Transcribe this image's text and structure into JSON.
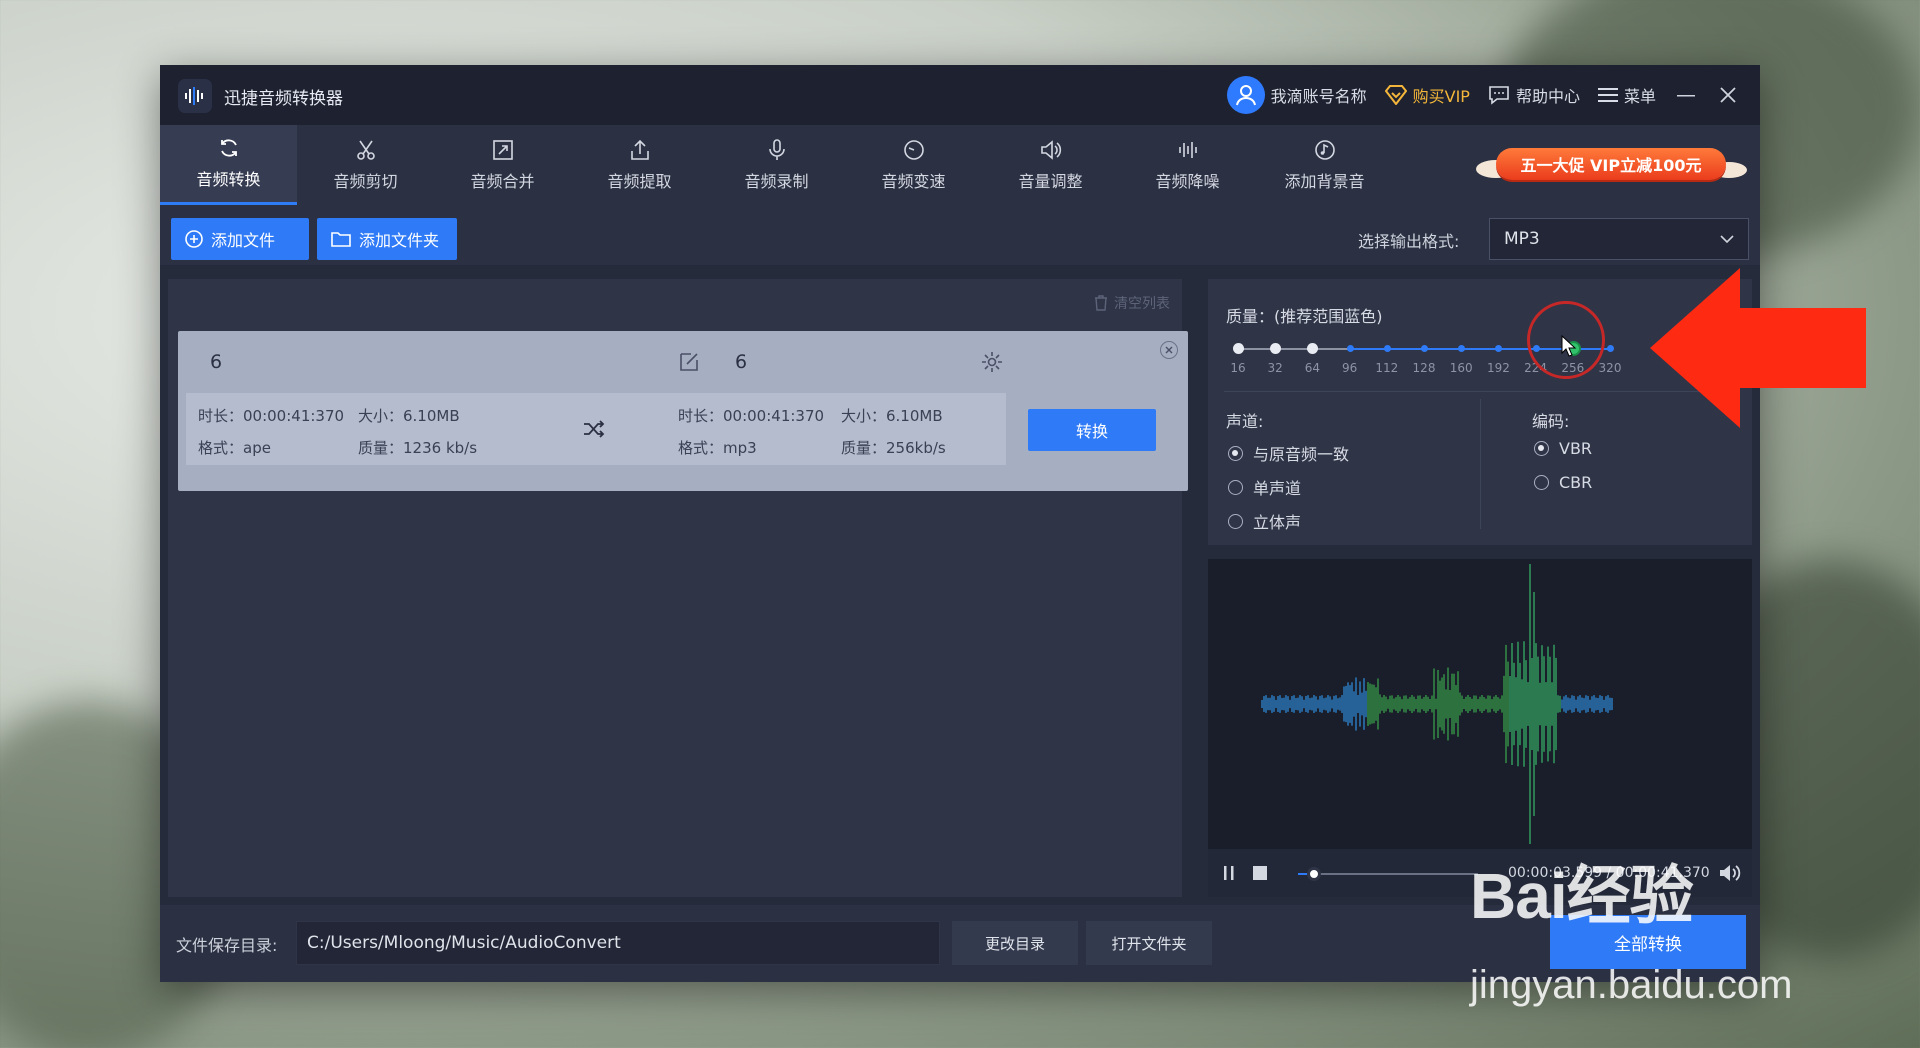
{
  "app": {
    "title": "迅捷音频转换器"
  },
  "titlebar": {
    "account_name": "我滴账号名称",
    "buy_vip": "购买VIP",
    "help_center": "帮助中心",
    "menu": "菜单"
  },
  "toolbar": {
    "tools": [
      {
        "label": "音频转换",
        "icon": "refresh-icon"
      },
      {
        "label": "音频剪切",
        "icon": "scissors-icon"
      },
      {
        "label": "音频合并",
        "icon": "merge-icon"
      },
      {
        "label": "音频提取",
        "icon": "upload-icon"
      },
      {
        "label": "音频录制",
        "icon": "microphone-icon"
      },
      {
        "label": "音频变速",
        "icon": "speed-icon"
      },
      {
        "label": "音量调整",
        "icon": "volume-icon"
      },
      {
        "label": "音频降噪",
        "icon": "equalizer-icon"
      },
      {
        "label": "添加背景音",
        "icon": "music-note-icon"
      }
    ],
    "promo": "五一大促 VIP立减100元"
  },
  "actions": {
    "add_file": "添加文件",
    "add_folder": "添加文件夹",
    "output_format_label": "选择输出格式:",
    "output_format_value": "MP3"
  },
  "list": {
    "clear": "清空列表",
    "file": {
      "source_name": "6",
      "target_name": "6",
      "src_duration": "时长：00:00:41:370",
      "src_size": "大小：6.10MB",
      "src_format": "格式：ape",
      "src_quality": "质量：1236 kb/s",
      "dst_duration": "时长：00:00:41:370",
      "dst_size": "大小：6.10MB",
      "dst_format": "格式：mp3",
      "dst_quality": "质量：256kb/s",
      "convert": "转换"
    }
  },
  "settings": {
    "quality_label": "质量：(推荐范围蓝色)",
    "quality_values": [
      "16",
      "32",
      "64",
      "96",
      "112",
      "128",
      "160",
      "192",
      "224",
      "256",
      "320"
    ],
    "selected_quality": "256",
    "channel_label": "声道:",
    "channels": [
      "与原音频一致",
      "单声道",
      "立体声"
    ],
    "selected_channel": "与原音频一致",
    "encoding_label": "编码:",
    "encodings": [
      "VBR",
      "CBR"
    ],
    "selected_encoding": "VBR",
    "accent_color": "#2f7bf7"
  },
  "player": {
    "time": "00:00:03.599 / 00:00:41.370",
    "progress": 0.087
  },
  "bottom": {
    "save_label": "文件保存目录:",
    "save_path": "C:/Users/Mloong/Music/AudioConvert",
    "change_dir": "更改目录",
    "open_folder": "打开文件夹",
    "convert_all": "全部转换"
  },
  "watermark": {
    "brand": "Bai经验",
    "url": "jingyan.baidu.com"
  }
}
